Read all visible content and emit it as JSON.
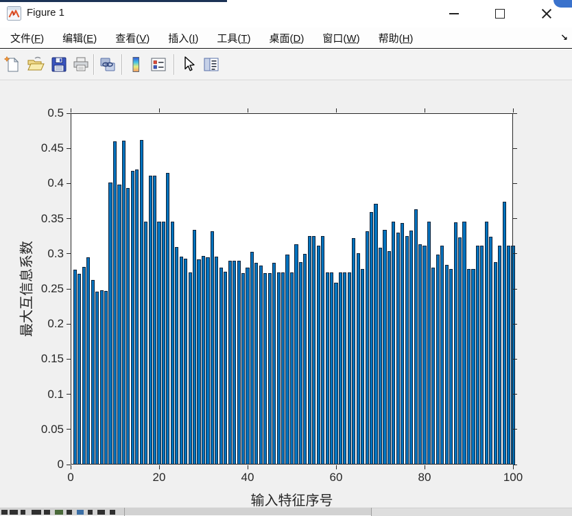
{
  "window": {
    "title": "Figure 1",
    "controls": {
      "minimize": "minimize",
      "maximize": "maximize",
      "close": "close"
    }
  },
  "menu": {
    "items": [
      {
        "prefix": "文件(",
        "key": "F",
        "suffix": ")"
      },
      {
        "prefix": "编辑(",
        "key": "E",
        "suffix": ")"
      },
      {
        "prefix": "查看(",
        "key": "V",
        "suffix": ")"
      },
      {
        "prefix": "插入(",
        "key": "I",
        "suffix": ")"
      },
      {
        "prefix": "工具(",
        "key": "T",
        "suffix": ")"
      },
      {
        "prefix": "桌面(",
        "key": "D",
        "suffix": ")"
      },
      {
        "prefix": "窗口(",
        "key": "W",
        "suffix": ")"
      },
      {
        "prefix": "帮助(",
        "key": "H",
        "suffix": ")"
      }
    ],
    "overflow_glyph": "↘"
  },
  "toolbar": {
    "icons": [
      "new-figure-icon",
      "open-file-icon",
      "save-figure-icon",
      "print-icon",
      "link-plot-icon",
      "insert-colorbar-icon",
      "insert-legend-icon",
      "edit-plot-icon",
      "property-inspector-icon"
    ]
  },
  "chart_data": {
    "type": "bar",
    "title": "",
    "xlabel": "输入特征序号",
    "ylabel": "最大互信息系数",
    "x_description": "feature index 1..100",
    "xlim": [
      0,
      100
    ],
    "ylim": [
      0,
      0.5
    ],
    "xticks": [
      0,
      20,
      40,
      60,
      80,
      100
    ],
    "yticks": [
      0,
      0.05,
      0.1,
      0.15,
      0.2,
      0.25,
      0.3,
      0.35,
      0.4,
      0.45,
      0.5
    ],
    "grid": false,
    "legend": null,
    "bar_color": "#0072BD",
    "bar_edge_color": "#0d2138",
    "values": [
      0.277,
      0.271,
      0.281,
      0.295,
      0.263,
      0.246,
      0.248,
      0.247,
      0.401,
      0.46,
      0.398,
      0.461,
      0.394,
      0.418,
      0.42,
      0.462,
      0.346,
      0.411,
      0.411,
      0.346,
      0.346,
      0.415,
      0.346,
      0.31,
      0.296,
      0.293,
      0.273,
      0.334,
      0.292,
      0.297,
      0.295,
      0.332,
      0.296,
      0.28,
      0.274,
      0.29,
      0.29,
      0.29,
      0.272,
      0.28,
      0.303,
      0.287,
      0.283,
      0.272,
      0.272,
      0.287,
      0.273,
      0.273,
      0.299,
      0.273,
      0.313,
      0.288,
      0.3,
      0.325,
      0.325,
      0.312,
      0.325,
      0.273,
      0.273,
      0.259,
      0.273,
      0.273,
      0.273,
      0.322,
      0.301,
      0.278,
      0.332,
      0.359,
      0.371,
      0.309,
      0.334,
      0.304,
      0.346,
      0.33,
      0.344,
      0.325,
      0.333,
      0.363,
      0.313,
      0.312,
      0.346,
      0.28,
      0.299,
      0.312,
      0.284,
      0.278,
      0.345,
      0.323,
      0.346,
      0.278,
      0.278,
      0.312,
      0.312,
      0.346,
      0.324,
      0.288,
      0.312,
      0.374,
      0.312,
      0.312
    ]
  }
}
